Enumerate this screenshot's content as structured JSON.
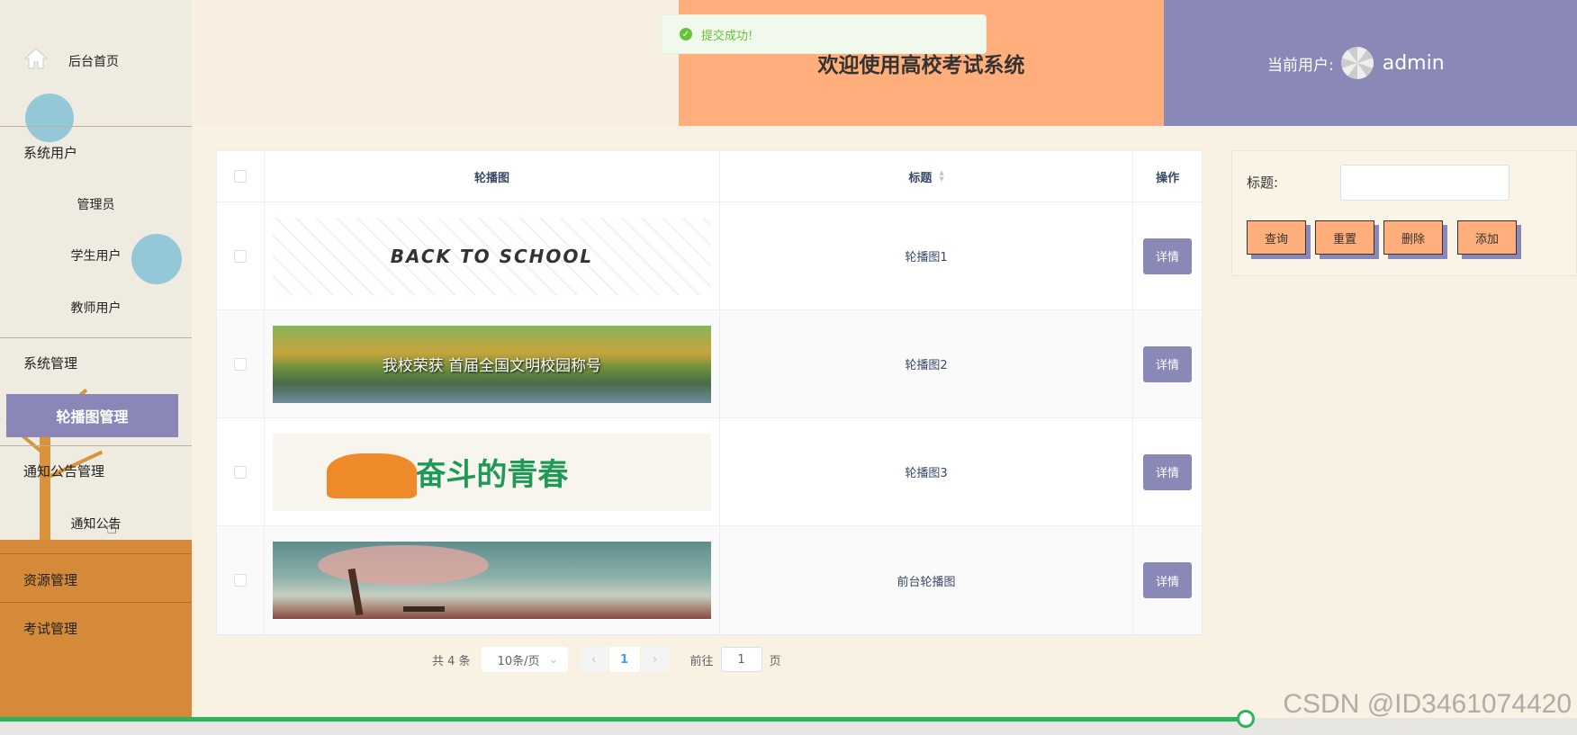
{
  "sidebar": {
    "home": "后台首页",
    "group_users": "系统用户",
    "admin": "管理员",
    "student": "学生用户",
    "teacher": "教师用户",
    "group_system": "系统管理",
    "carousel_mgmt": "轮播图管理",
    "group_notice": "通知公告管理",
    "notice": "通知公告",
    "group_resource": "资源管理",
    "group_exam": "考试管理"
  },
  "header": {
    "title": "欢迎使用高校考试系统",
    "current_user_label": "当前用户:",
    "username": "admin"
  },
  "toast": {
    "message": "提交成功!"
  },
  "table": {
    "columns": [
      "轮播图",
      "标题",
      "操作"
    ],
    "rows": [
      {
        "banner_text": "BACK TO SCHOOL",
        "title": "轮播图1",
        "action": "详情"
      },
      {
        "banner_text": "我校荣获 首届全国文明校园称号",
        "title": "轮播图2",
        "action": "详情"
      },
      {
        "banner_text": "奋斗的青春",
        "title": "轮播图3",
        "action": "详情"
      },
      {
        "banner_text": "",
        "title": "前台轮播图",
        "action": "详情"
      }
    ]
  },
  "pagination": {
    "total": "共 4 条",
    "page_size": "10条/页",
    "current_page": "1",
    "goto_label": "前往",
    "goto_value": "1",
    "page_suffix": "页"
  },
  "search": {
    "title_label": "标题:",
    "buttons": {
      "query": "查询",
      "reset": "重置",
      "delete": "删除",
      "add": "添加"
    }
  },
  "progress": {
    "fraction": 0.79
  },
  "watermark": "CSDN @ID3461074420",
  "colors": {
    "accent_purple": "#8a88b6",
    "accent_orange": "#ffae7c",
    "sidebar_bottom": "#d48a38",
    "progress": "#2db35d"
  }
}
